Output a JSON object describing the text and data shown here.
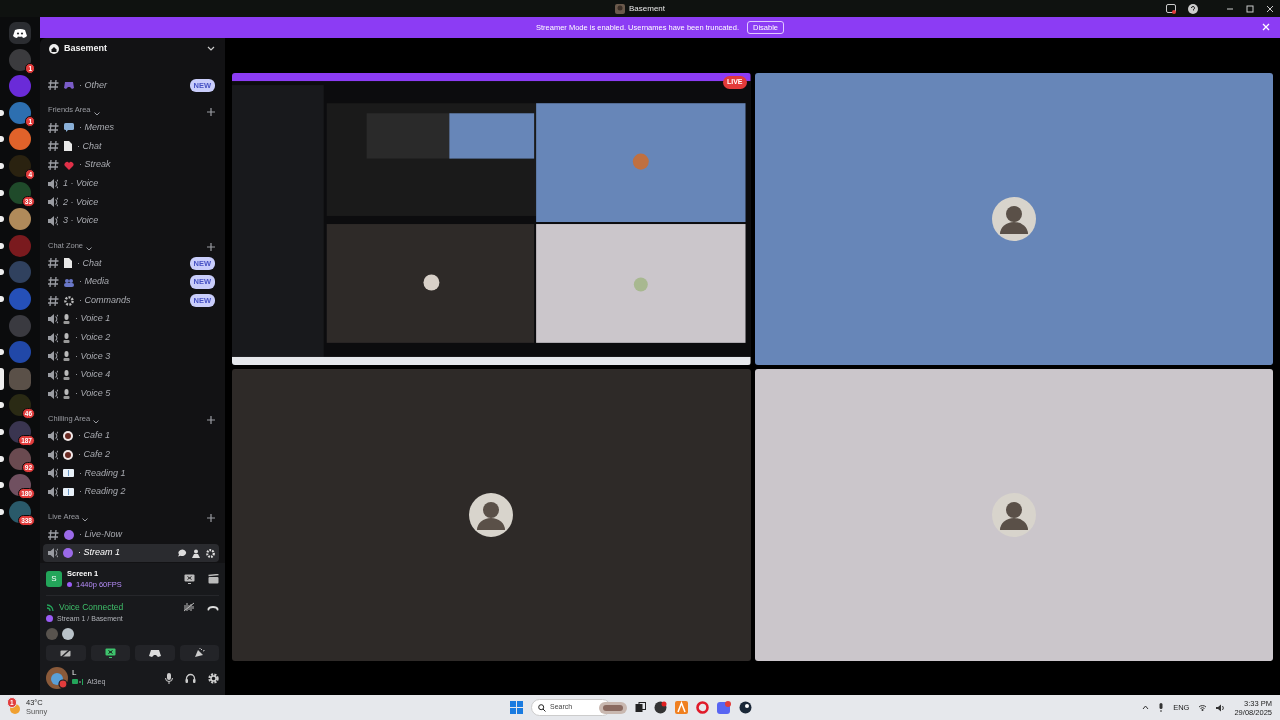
{
  "window": {
    "title": "Basement"
  },
  "banner": {
    "text": "Streamer Mode is enabled. Usernames have been truncated.",
    "button": "Disable"
  },
  "servers": [
    {
      "kind": "home",
      "selected": false,
      "unread": false
    },
    {
      "kind": "server",
      "color": "#3b3b3e",
      "badge": "1",
      "selected": false,
      "unread": false
    },
    {
      "kind": "server",
      "color": "#6a2bd8",
      "selected": false,
      "unread": false
    },
    {
      "kind": "server",
      "color": "#2d6fb0",
      "badge": "1",
      "selected": false,
      "unread": true
    },
    {
      "kind": "server",
      "color": "#e0622a",
      "selected": false,
      "unread": true
    },
    {
      "kind": "server",
      "color": "#2a2210",
      "badge": "4",
      "selected": false,
      "unread": true
    },
    {
      "kind": "server",
      "color": "#1f4a2a",
      "badge": "33",
      "selected": false,
      "unread": true
    },
    {
      "kind": "server",
      "color": "#b08a5a",
      "selected": false,
      "unread": true
    },
    {
      "kind": "server",
      "color": "#7a1a1e",
      "selected": false,
      "unread": true
    },
    {
      "kind": "server",
      "color": "#30415e",
      "selected": false,
      "unread": true
    },
    {
      "kind": "server",
      "color": "#2550b8",
      "selected": false,
      "unread": true
    },
    {
      "kind": "server",
      "color": "#3a3a40",
      "selected": false,
      "unread": false
    },
    {
      "kind": "server",
      "color": "#2148a8",
      "selected": false,
      "unread": true
    },
    {
      "kind": "server",
      "color": "#5a5048",
      "selected": true,
      "unread": false
    },
    {
      "kind": "server",
      "color": "#2a2a14",
      "badge": "46",
      "selected": false,
      "unread": true
    },
    {
      "kind": "server",
      "color": "#3a3550",
      "badge": "187",
      "selected": false,
      "unread": true
    },
    {
      "kind": "server",
      "color": "#6a4a50",
      "badge": "92",
      "selected": false,
      "unread": true
    },
    {
      "kind": "server",
      "color": "#705060",
      "badge": "180",
      "selected": false,
      "unread": true
    },
    {
      "kind": "server",
      "color": "#2a5a6a",
      "badge": "338",
      "selected": false,
      "unread": true
    }
  ],
  "guild": {
    "name": "Basement"
  },
  "top_channels": [
    {
      "kind": "text",
      "emoji": {
        "kind": "gamepad"
      },
      "label": "· Other",
      "badge": "NEW",
      "selected": false
    }
  ],
  "categories": [
    {
      "name": "Friends Area",
      "channels": [
        {
          "kind": "text",
          "emoji": {
            "kind": "speech"
          },
          "label": "· Memes",
          "selected": false
        },
        {
          "kind": "text",
          "emoji": {
            "kind": "page"
          },
          "label": "· Chat",
          "selected": false
        },
        {
          "kind": "text",
          "emoji": {
            "kind": "heart"
          },
          "label": "· Streak",
          "selected": false
        },
        {
          "kind": "voice",
          "label": "1 · Voice",
          "selected": false
        },
        {
          "kind": "voice",
          "label": "2 · Voice",
          "selected": false
        },
        {
          "kind": "voice",
          "label": "3 · Voice",
          "selected": false
        }
      ]
    },
    {
      "name": "Chat Zone",
      "channels": [
        {
          "kind": "text",
          "emoji": {
            "kind": "page"
          },
          "label": "· Chat",
          "badge": "NEW",
          "selected": false
        },
        {
          "kind": "text",
          "emoji": {
            "kind": "group"
          },
          "label": "· Media",
          "badge": "NEW",
          "selected": false
        },
        {
          "kind": "text",
          "emoji": {
            "kind": "gear"
          },
          "label": "· Commands",
          "badge": "NEW",
          "selected": false
        },
        {
          "kind": "voice",
          "emoji": {
            "kind": "mic"
          },
          "label": "· Voice 1",
          "selected": false
        },
        {
          "kind": "voice",
          "emoji": {
            "kind": "mic"
          },
          "label": "· Voice 2",
          "selected": false
        },
        {
          "kind": "voice",
          "emoji": {
            "kind": "mic"
          },
          "label": "· Voice 3",
          "selected": false
        },
        {
          "kind": "voice",
          "emoji": {
            "kind": "mic"
          },
          "label": "· Voice 4",
          "selected": false
        },
        {
          "kind": "voice",
          "emoji": {
            "kind": "mic"
          },
          "label": "· Voice 5",
          "selected": false
        }
      ]
    },
    {
      "name": "Chilling Area",
      "channels": [
        {
          "kind": "voice",
          "emoji": {
            "kind": "coffee"
          },
          "label": "· Cafe 1",
          "selected": false
        },
        {
          "kind": "voice",
          "emoji": {
            "kind": "coffee"
          },
          "label": "· Cafe 2",
          "selected": false
        },
        {
          "kind": "voice",
          "emoji": {
            "kind": "book"
          },
          "label": "· Reading 1",
          "selected": false
        },
        {
          "kind": "voice",
          "emoji": {
            "kind": "book"
          },
          "label": "· Reading 2",
          "selected": false
        }
      ]
    },
    {
      "name": "Live Area",
      "channels": [
        {
          "kind": "text",
          "emoji": {
            "kind": "circle"
          },
          "label": "· Live-Now",
          "selected": false
        },
        {
          "kind": "voice",
          "emoji": {
            "kind": "circle"
          },
          "label": "· Stream 1",
          "selected": true
        }
      ]
    }
  ],
  "stream_panel": {
    "avatar": "S",
    "title": "Screen 1",
    "quality": "1440p 60FPS"
  },
  "voice": {
    "status": "Voice Connected",
    "channel": "Stream 1 / Basement"
  },
  "user": {
    "name": "L",
    "status": "At3eq"
  },
  "tiles": [
    {
      "kind": "screen",
      "badge": "LIVE"
    },
    {
      "kind": "avatar",
      "color": "#6786b8"
    },
    {
      "kind": "avatar",
      "color": "#2e2a28"
    },
    {
      "kind": "avatar",
      "color": "#cbc6cb"
    }
  ],
  "taskbar": {
    "temperature": "43°C",
    "weather": "Sunny",
    "weather_badge": "1",
    "search": "Search",
    "language": "ENG",
    "time": "3:33 PM",
    "date": "29/08/2025"
  }
}
